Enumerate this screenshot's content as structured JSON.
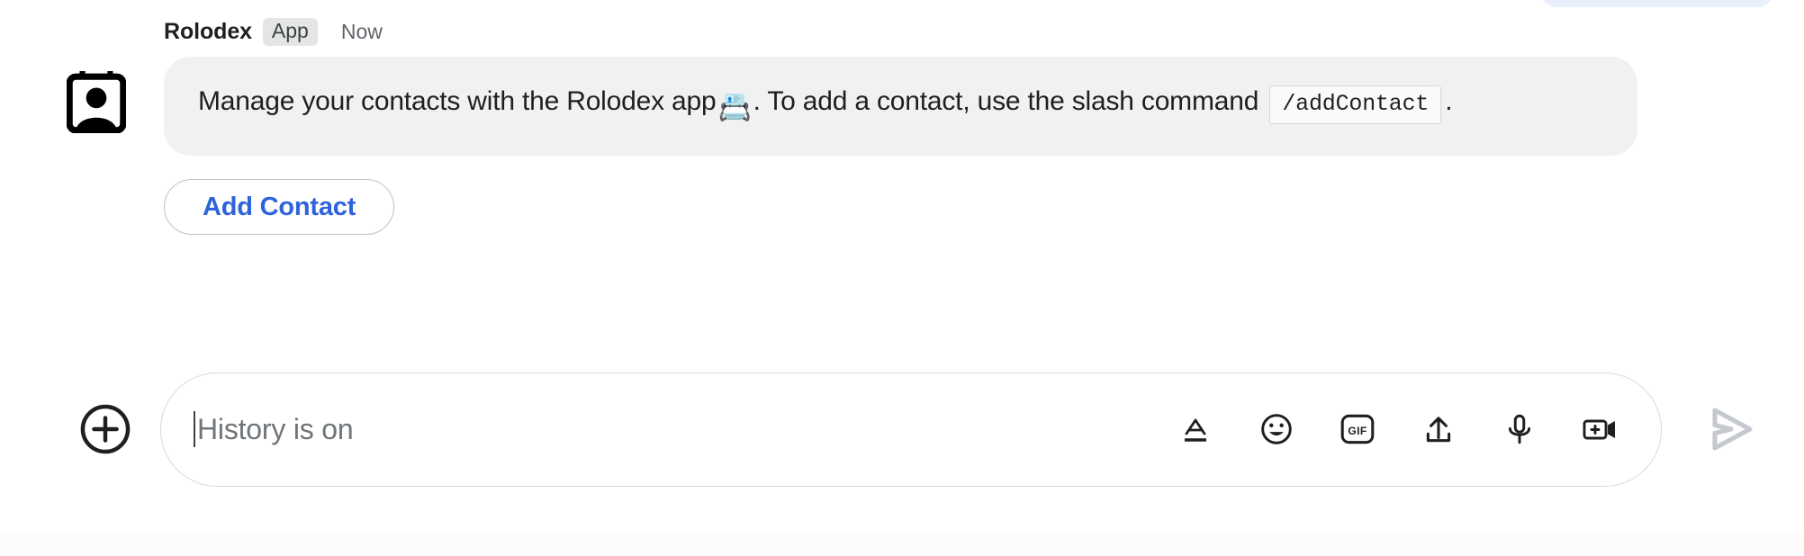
{
  "message": {
    "sender": "Rolodex",
    "badge": "App",
    "timestamp": "Now",
    "avatar_icon": "contact-card-icon",
    "body_part1": "Manage your contacts with the Rolodex app",
    "body_emoji": "📇",
    "body_part2": ". To add a contact, use the slash command",
    "code_command": "/addContact",
    "body_part3": ".",
    "bubble_color": "#F1F1F1"
  },
  "actions": {
    "primary_button": "Add Contact",
    "primary_button_color": "#2F63DC"
  },
  "composer": {
    "add_icon": "plus-circle-icon",
    "placeholder": "History is on",
    "value": "",
    "tools": [
      {
        "name": "format-text-icon",
        "label": "A"
      },
      {
        "name": "emoji-icon",
        "label": ""
      },
      {
        "name": "gif-icon",
        "label": "GIF"
      },
      {
        "name": "upload-icon",
        "label": ""
      },
      {
        "name": "microphone-icon",
        "label": ""
      },
      {
        "name": "video-add-icon",
        "label": ""
      }
    ],
    "send_icon": "send-arrow-icon",
    "send_enabled": "false",
    "send_color": "#C5C9CE"
  }
}
